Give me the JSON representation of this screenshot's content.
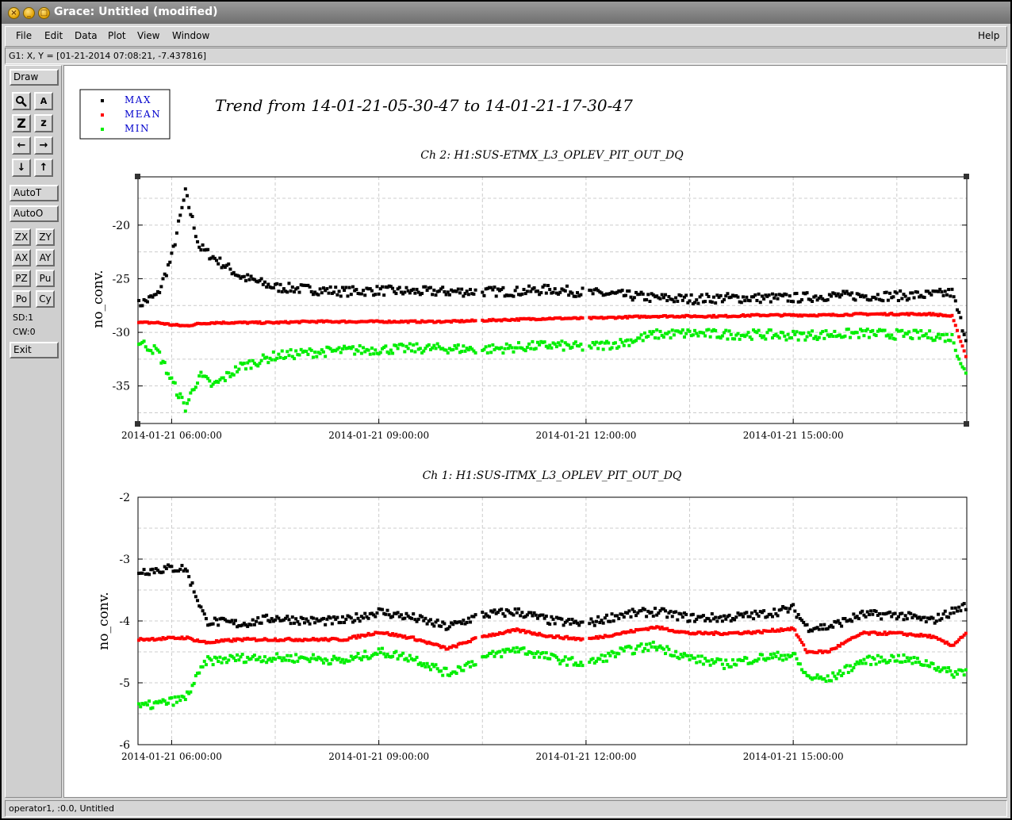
{
  "window": {
    "title": "Grace: Untitled (modified)"
  },
  "menubar": {
    "items": [
      "File",
      "Edit",
      "Data",
      "Plot",
      "View",
      "Window"
    ],
    "help": "Help"
  },
  "locator": "G1: X, Y = [01-21-2014 07:08:21, -7.437816]",
  "toolbox": {
    "draw": "Draw",
    "zoom_icons": [
      "zoom-icon",
      "text-zoom-icon",
      "zoom-in-icon",
      "zoom-out-icon",
      "arrow-left-icon",
      "arrow-right-icon",
      "arrow-down-icon",
      "arrow-up-icon"
    ],
    "zoom_labels": [
      "",
      "A",
      "Z",
      "z",
      "←",
      "→",
      "↓",
      "↑"
    ],
    "autot": "AutoT",
    "autoo": "AutoO",
    "small_buttons": [
      "ZX",
      "ZY",
      "AX",
      "AY",
      "PZ",
      "Pu",
      "Po",
      "Cy"
    ],
    "sd": "SD:1",
    "cw": "CW:0",
    "exit": "Exit"
  },
  "statusbar": "operator1, :0.0, Untitled",
  "colors": {
    "max": "#000000",
    "mean": "#ff0000",
    "min": "#00ee00",
    "legend_text": "#0000cc"
  },
  "chart_data": {
    "title": "Trend from 14-01-21-05-30-47 to 14-01-21-17-30-47",
    "legend": [
      "MAX",
      "MEAN",
      "MIN"
    ],
    "x_ticks": [
      "2014-01-21 06:00:00",
      "2014-01-21 09:00:00",
      "2014-01-21 12:00:00",
      "2014-01-21 15:00:00"
    ],
    "x_range": [
      "2014-01-21 05:30:47",
      "2014-01-21 17:30:47"
    ],
    "panels": [
      {
        "title": "Ch 2: H1:SUS-ETMX_L3_OPLEV_PIT_OUT_DQ",
        "ylabel": "no_conv.",
        "ylim": [
          -38.5,
          -15.5
        ],
        "y_ticks": [
          "-20",
          "-25",
          "-30",
          "-35"
        ],
        "y_tick_values": [
          -20,
          -25,
          -30,
          -35
        ],
        "series_hours": [
          5.5,
          5.8,
          6.0,
          6.2,
          6.4,
          6.6,
          7.0,
          7.5,
          8.0,
          8.5,
          9.0,
          9.5,
          10.0,
          10.5,
          11.0,
          11.5,
          12.0,
          12.5,
          13.0,
          13.5,
          14.0,
          14.5,
          15.0,
          15.5,
          16.0,
          16.5,
          17.0,
          17.3,
          17.5
        ],
        "max": [
          -27.5,
          -26.5,
          -23.0,
          -17.0,
          -22.0,
          -23.0,
          -24.8,
          -25.8,
          -26.0,
          -26.2,
          -26.1,
          -26.2,
          -26.2,
          -26.2,
          -26.2,
          -26.0,
          -26.3,
          -26.5,
          -26.8,
          -26.9,
          -26.8,
          -26.8,
          -26.8,
          -26.6,
          -26.6,
          -26.6,
          -26.5,
          -26.3,
          -30.5
        ],
        "mean": [
          -29.1,
          -29.1,
          -29.3,
          -29.4,
          -29.2,
          -29.1,
          -29.1,
          -29.1,
          -29.0,
          -29.0,
          -29.0,
          -29.0,
          -29.0,
          -28.9,
          -28.8,
          -28.7,
          -28.7,
          -28.6,
          -28.5,
          -28.5,
          -28.5,
          -28.4,
          -28.4,
          -28.4,
          -28.3,
          -28.3,
          -28.3,
          -28.5,
          -32.2
        ],
        "min": [
          -30.8,
          -31.8,
          -34.5,
          -37.0,
          -34.0,
          -35.0,
          -33.2,
          -32.2,
          -31.9,
          -31.7,
          -31.6,
          -31.5,
          -31.5,
          -31.6,
          -31.4,
          -31.2,
          -31.4,
          -31.0,
          -30.2,
          -30.1,
          -30.2,
          -30.2,
          -30.3,
          -30.2,
          -30.1,
          -30.2,
          -30.3,
          -30.5,
          -34.0
        ],
        "gap_after_hour": 17.3
      },
      {
        "title": "Ch 1: H1:SUS-ITMX_L3_OPLEV_PIT_OUT_DQ",
        "ylabel": "no_conv.",
        "ylim": [
          -6,
          -2
        ],
        "y_ticks": [
          "-2",
          "-3",
          "-4",
          "-5",
          "-6"
        ],
        "y_tick_values": [
          -2,
          -3,
          -4,
          -5,
          -6
        ],
        "series_hours": [
          5.5,
          6.0,
          6.2,
          6.5,
          7.0,
          7.5,
          8.0,
          8.5,
          9.0,
          9.5,
          10.0,
          10.5,
          11.0,
          11.5,
          12.0,
          12.5,
          13.0,
          13.5,
          14.0,
          14.5,
          15.0,
          15.2,
          15.5,
          16.0,
          16.5,
          17.0,
          17.3,
          17.5
        ],
        "max": [
          -3.2,
          -3.15,
          -3.15,
          -4.0,
          -4.05,
          -3.95,
          -4.0,
          -4.0,
          -3.85,
          -3.95,
          -4.1,
          -3.9,
          -3.85,
          -4.0,
          -4.05,
          -3.9,
          -3.85,
          -3.95,
          -3.95,
          -3.9,
          -3.8,
          -4.1,
          -4.1,
          -3.9,
          -3.9,
          -4.0,
          -3.85,
          -3.75
        ],
        "mean": [
          -4.3,
          -4.28,
          -4.27,
          -4.35,
          -4.3,
          -4.3,
          -4.3,
          -4.3,
          -4.18,
          -4.28,
          -4.45,
          -4.25,
          -4.15,
          -4.25,
          -4.3,
          -4.2,
          -4.1,
          -4.2,
          -4.2,
          -4.18,
          -4.12,
          -4.5,
          -4.5,
          -4.2,
          -4.2,
          -4.25,
          -4.4,
          -4.2
        ],
        "min": [
          -5.4,
          -5.3,
          -5.25,
          -4.65,
          -4.6,
          -4.6,
          -4.6,
          -4.65,
          -4.5,
          -4.6,
          -4.85,
          -4.6,
          -4.45,
          -4.6,
          -4.7,
          -4.5,
          -4.4,
          -4.6,
          -4.7,
          -4.6,
          -4.55,
          -4.9,
          -4.95,
          -4.65,
          -4.6,
          -4.7,
          -4.85,
          -4.8
        ],
        "jump_after_hour": 6.2
      }
    ]
  }
}
